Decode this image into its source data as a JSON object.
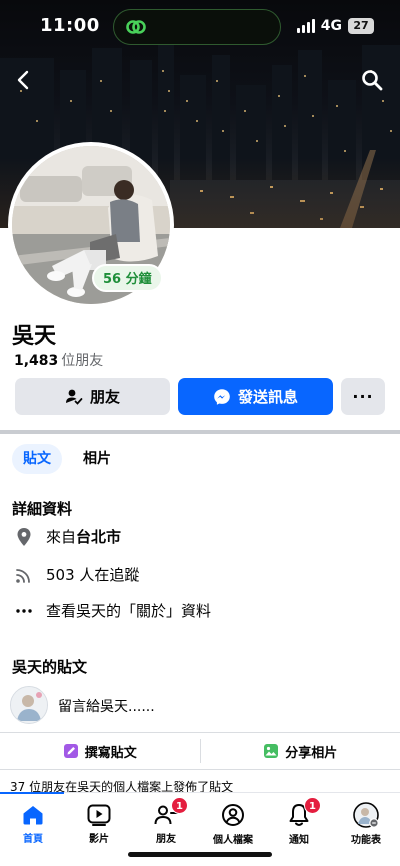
{
  "status": {
    "time": "11:00",
    "network": "4G",
    "battery": "27"
  },
  "profile": {
    "name": "吳天",
    "friend_count": "1,483",
    "friend_suffix": "位朋友",
    "active_badge": "56 分鐘"
  },
  "actions": {
    "friends": "朋友",
    "message": "發送訊息",
    "more": "···"
  },
  "tabs": [
    {
      "label": "貼文",
      "active": true
    },
    {
      "label": "相片",
      "active": false
    }
  ],
  "details": {
    "title": "詳細資料",
    "location_prefix": "來自",
    "location": "台北市",
    "followers": "503 人在追蹤",
    "about": "查看吳天的「關於」資料"
  },
  "posts": {
    "title": "吳天的貼文",
    "composer_placeholder": "留言給吳天......",
    "write_post": "撰寫貼文",
    "share_photo": "分享相片",
    "note": "37 位朋友在吳天的個人檔案上發佈了貼文"
  },
  "bottom_nav": [
    {
      "label": "首頁",
      "icon": "home-icon",
      "active": true,
      "badge": null
    },
    {
      "label": "影片",
      "icon": "video-icon",
      "active": false,
      "badge": null
    },
    {
      "label": "朋友",
      "icon": "friends-icon",
      "active": false,
      "badge": "1"
    },
    {
      "label": "個人檔案",
      "icon": "profile-icon",
      "active": false,
      "badge": null
    },
    {
      "label": "通知",
      "icon": "bell-icon",
      "active": false,
      "badge": "1"
    },
    {
      "label": "功能表",
      "icon": "menu-avatar-icon",
      "active": false,
      "badge": null
    }
  ],
  "colors": {
    "accent": "#0866ff",
    "badge_red": "#e41e3f",
    "active_green": "#1f8f3a"
  }
}
